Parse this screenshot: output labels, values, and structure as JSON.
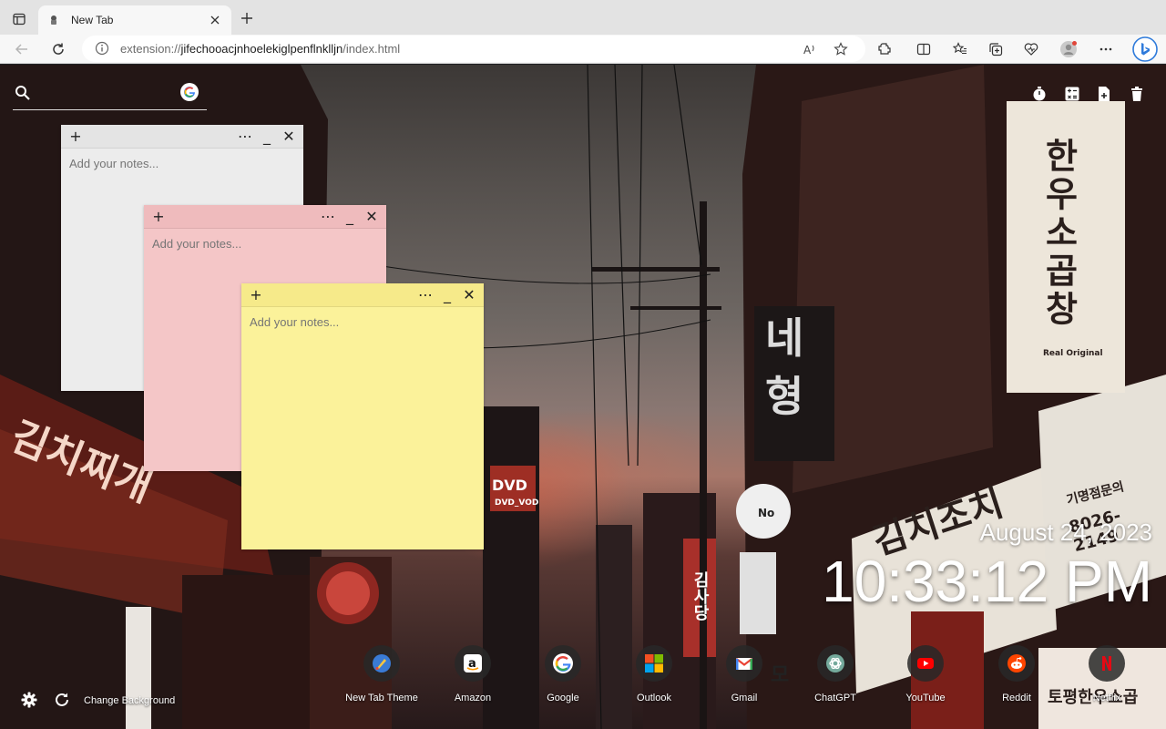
{
  "browser": {
    "tab_title": "New Tab",
    "url_prefix": "extension://",
    "url_host": "jifechooacjnhoelekiglpenflnklljn",
    "url_path": "/index.html"
  },
  "search": {
    "placeholder": ""
  },
  "notes": [
    {
      "color": "#ececec",
      "header_color": "#e4e4e4",
      "placeholder": "Add your notes..."
    },
    {
      "color": "#f4c6c7",
      "header_color": "#efbbbd",
      "placeholder": "Add your notes..."
    },
    {
      "color": "#fbf29a",
      "header_color": "#f6ea8a",
      "placeholder": "Add your notes..."
    }
  ],
  "clock": {
    "date": "August 24, 2023",
    "time": "10:33:12 PM"
  },
  "shortcuts": [
    {
      "label": "New Tab Theme",
      "icon": "new-tab-theme-icon"
    },
    {
      "label": "Amazon",
      "icon": "amazon-icon"
    },
    {
      "label": "Google",
      "icon": "google-icon"
    },
    {
      "label": "Outlook",
      "icon": "outlook-icon"
    },
    {
      "label": "Gmail",
      "icon": "gmail-icon"
    },
    {
      "label": "ChatGPT",
      "icon": "chatgpt-icon"
    },
    {
      "label": "YouTube",
      "icon": "youtube-icon"
    },
    {
      "label": "Reddit",
      "icon": "reddit-icon"
    },
    {
      "label": "Netflix",
      "icon": "netflix-icon"
    }
  ],
  "bottom": {
    "change_background": "Change Background"
  },
  "signs": {
    "s1": "네",
    "s2": "형",
    "s3": "한우소곱창",
    "s4": "김치조치",
    "s5": "김치찌개",
    "s6": "DVD",
    "s7": "DVD_VOD",
    "s8": "No",
    "s9": "기명점문의",
    "s10": "8026-2149",
    "s11": "토평한우쇼곱",
    "s12": "김사당",
    "s13": "모",
    "s14": "Real Original"
  }
}
